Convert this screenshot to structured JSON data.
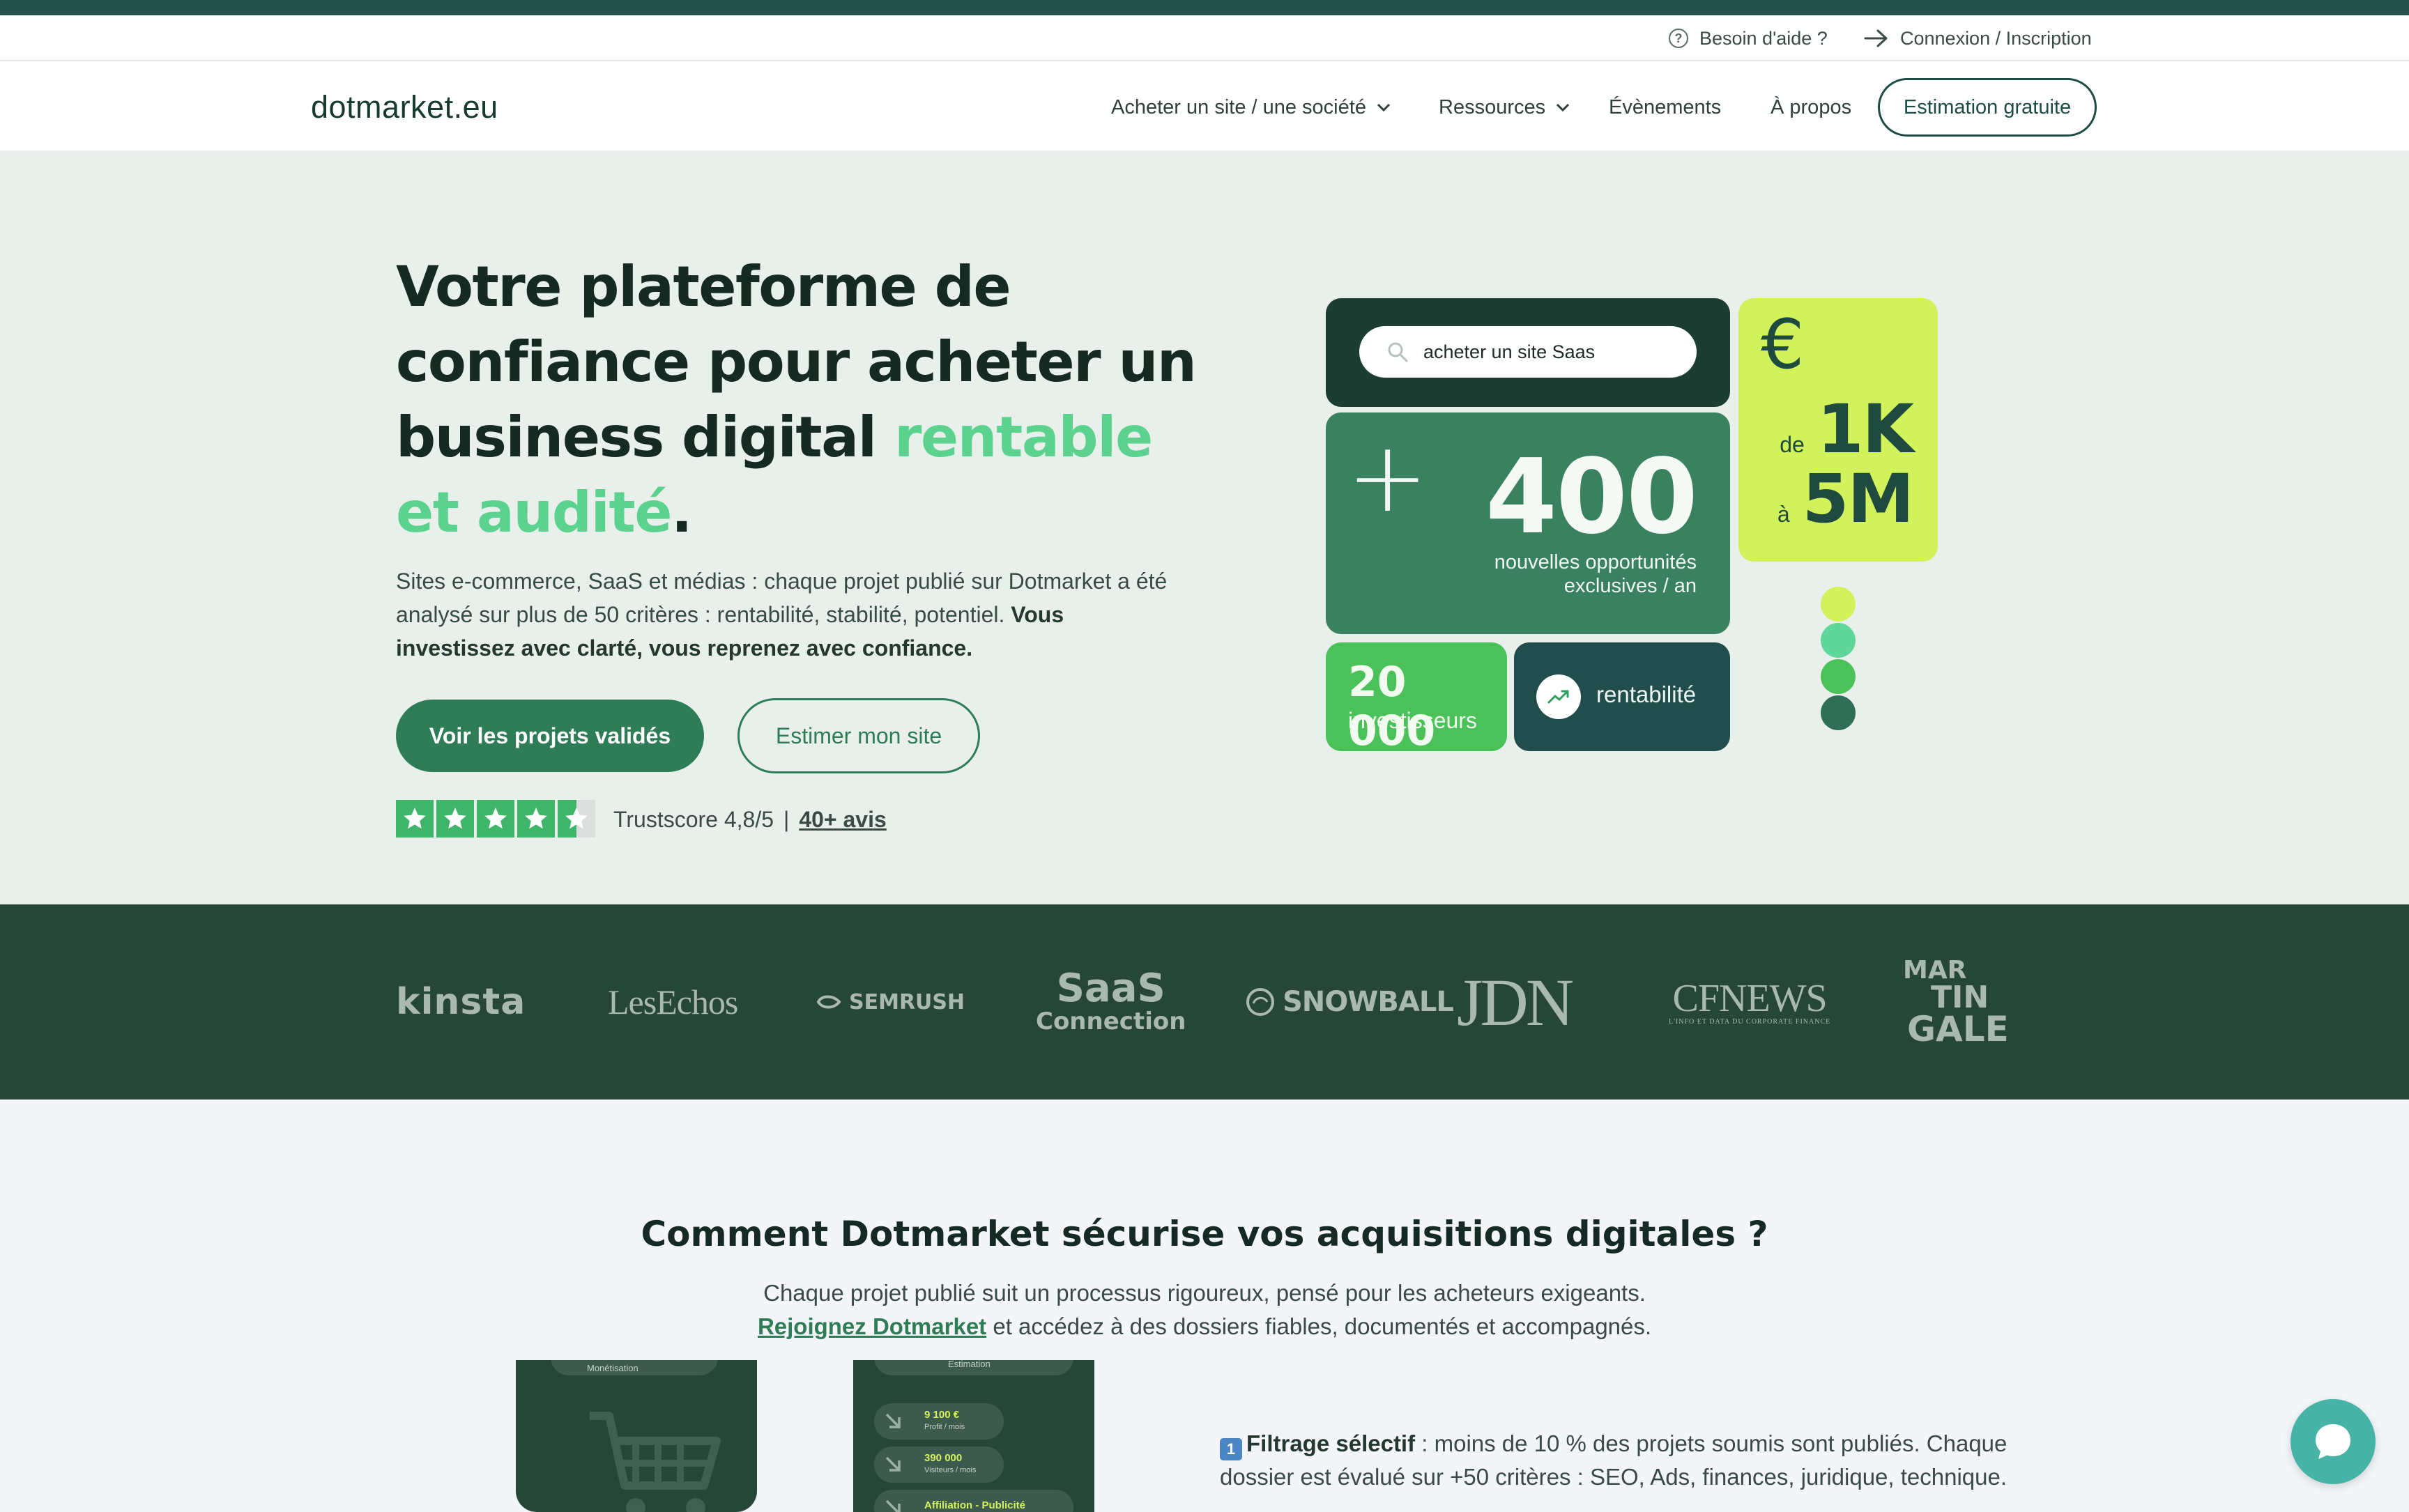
{
  "util": {
    "help": "Besoin d'aide ?",
    "login": "Connexion / Inscription"
  },
  "nav": {
    "logo": "dotmarket.eu",
    "items": [
      "Acheter un site / une société",
      "Ressources",
      "Évènements",
      "À propos"
    ],
    "cta": "Estimation gratuite"
  },
  "hero": {
    "title_main": "Votre plateforme de confiance pour acheter un business digital ",
    "title_accent": "rentable et audité",
    "title_end": ".",
    "subtitle": "Sites e-commerce, SaaS et médias : chaque projet publié sur Dotmarket a été analysé sur plus de 50 critères : rentabilité, stabilité, potentiel. ",
    "subtitle_bold": "Vous investissez avec clarté, vous reprenez avec confiance.",
    "btn_primary": "Voir les projets validés",
    "btn_secondary": "Estimer mon site",
    "trust_rating": 4.5,
    "trust_text": "Trustscore 4,8/5",
    "trust_sep": "|",
    "trust_link": "40+ avis"
  },
  "cards": {
    "search": "acheter un site Saas",
    "plus": "+",
    "opportunities_num": "400",
    "opportunities_line1": "nouvelles opportunités",
    "opportunities_line2": "exclusives / an",
    "euro": "€",
    "range_from_label": "de",
    "range_from": "1K",
    "range_to_label": "à",
    "range_to": "5M",
    "investors_num": "20 000",
    "investors_label": "investisseurs",
    "rent_label": "rentabilité",
    "dot_colors": [
      "#d1f25a",
      "#5fd79a",
      "#4bc15a",
      "#2f6f58"
    ]
  },
  "logos": {
    "kinsta": "kinsta",
    "lesechos": "LesEchos",
    "semrush": "SEMRUSH",
    "saas_a": "SaaS",
    "saas_b": "Connection",
    "snowball": "SNOWBALL",
    "jdn": "JDN",
    "cfnews_a": "CFNEWS",
    "cfnews_b": "L'INFO ET DATA DU CORPORATE FINANCE",
    "mart_a": "MAR",
    "mart_b": "TIN",
    "mart_c": "GALE"
  },
  "section2": {
    "title": "Comment Dotmarket sécurise vos acquisitions digitales ?",
    "sub_line1": "Chaque projet publié suit un processus rigoureux, pensé pour les acheteurs exigeants.",
    "sub_link": "Rejoignez Dotmarket",
    "sub_line2": " et accédez à des dossiers fiables, documentés et accompagnés.",
    "shot1_label": "Monétisation",
    "shot2_label": "Estimation",
    "shot2_rows": [
      {
        "value": "9 100 €",
        "label": "Profit / mois"
      },
      {
        "value": "390 000",
        "label": "Visiteurs / mois"
      },
      {
        "value": "Affiliation - Publicité",
        "label": ""
      }
    ],
    "feature_num": "1",
    "feature_bold": "Filtrage sélectif",
    "feature_text": " : moins de 10 % des projets soumis sont publiés. Chaque dossier est évalué sur +50 critères : SEO, Ads, finances, juridique, technique."
  },
  "colors": {
    "brand_dark": "#264738",
    "brand_green": "#2e7d57",
    "accent_mint": "#5bd38f",
    "lime": "#d1f25a",
    "hero_bg": "#e9f0ec",
    "chat": "#45b4a6"
  }
}
